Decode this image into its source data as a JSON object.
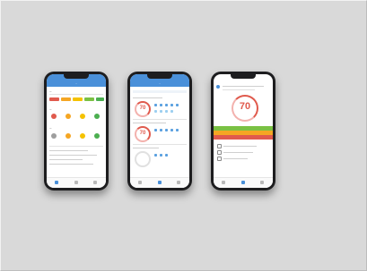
{
  "phone1": {
    "title": "...",
    "section1": "...",
    "section2": "...",
    "section3": "...",
    "status_colors": [
      "#e05a4d",
      "#f5a623",
      "#f5c200",
      "#7ac143",
      "#4caf50"
    ]
  },
  "phone2": {
    "title": "...",
    "score1": "70",
    "score2": "70"
  },
  "phone3": {
    "score": "70",
    "bands": [
      {
        "color": "#7ac143"
      },
      {
        "color": "#f5a623"
      },
      {
        "color": "#e05a4d"
      }
    ]
  }
}
